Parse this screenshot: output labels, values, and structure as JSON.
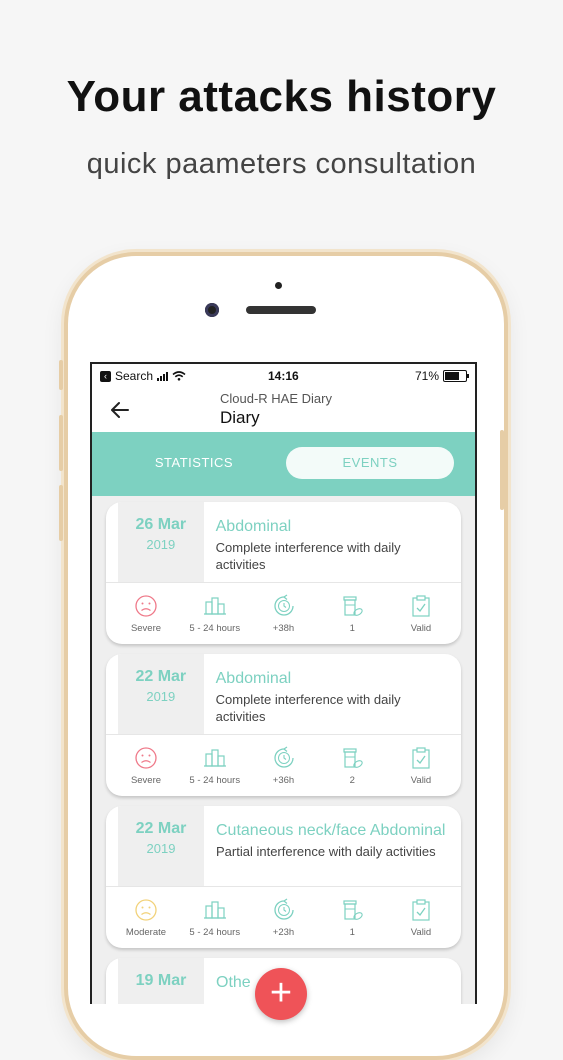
{
  "promo": {
    "headline": "Your attacks history",
    "subline": "quick paameters consultation"
  },
  "statusbar": {
    "carrier": "Search",
    "time": "14:16",
    "battery": "71%",
    "battery_level": 0.71
  },
  "appbar": {
    "app_name": "Cloud-R HAE Diary",
    "title": "Diary",
    "back_icon": "arrow-left-icon"
  },
  "tabs": [
    {
      "label": "STATISTICS",
      "active": false
    },
    {
      "label": "EVENTS",
      "active": true
    }
  ],
  "events": [
    {
      "day": "26 Mar",
      "year": "2019",
      "location": "Abdominal",
      "impact": "Complete interference with daily activities",
      "metrics": [
        "Severe",
        "5 - 24 hours",
        "+38h",
        "1",
        "Valid"
      ]
    },
    {
      "day": "22 Mar",
      "year": "2019",
      "location": "Abdominal",
      "impact": "Complete interference with daily activities",
      "metrics": [
        "Severe",
        "5 - 24 hours",
        "+36h",
        "2",
        "Valid"
      ]
    },
    {
      "day": "22 Mar",
      "year": "2019",
      "location": "Cutaneous neck/face Abdominal",
      "impact": "Partial interference with daily activities",
      "metrics": [
        "Moderate",
        "5 - 24 hours",
        "+23h",
        "1",
        "Valid"
      ]
    },
    {
      "day": "19 Mar",
      "location": "Othe"
    }
  ],
  "colors": {
    "accent": "#7dd1c1",
    "severe": "#ef7a8a",
    "moderate": "#f2d27a",
    "fab": "#ef5358"
  },
  "fab": {
    "label": "+"
  }
}
